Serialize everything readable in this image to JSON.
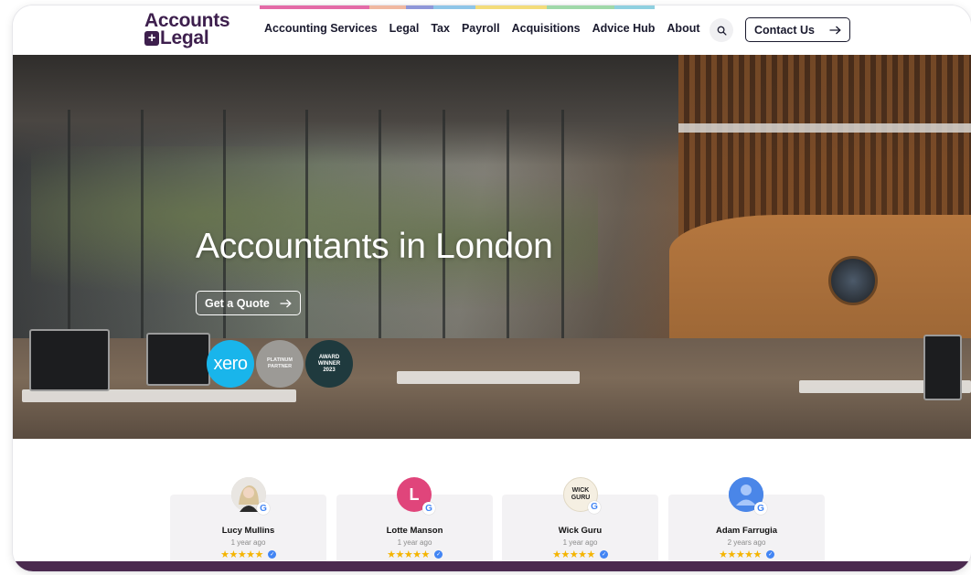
{
  "header": {
    "logo_line1": "Accounts",
    "logo_line2": "Legal",
    "nav": [
      "Accounting Services",
      "Legal",
      "Tax",
      "Payroll",
      "Acquisitions",
      "Advice Hub",
      "About"
    ],
    "contact_label": "Contact Us",
    "search_icon": "search-icon",
    "strip_colors": [
      "#e46aa7",
      "#f0b8a0",
      "#8e96d8",
      "#8ec5e8",
      "#f3dc7a",
      "#9fd8a8",
      "#8fd0e0"
    ]
  },
  "hero": {
    "title": "Accountants in London",
    "cta_label": "Get a Quote",
    "badges": {
      "xero": "xero",
      "platinum_line1": "PLATINUM",
      "platinum_line2": "PARTNER",
      "award_line1": "AWARD",
      "award_line2": "WINNER",
      "award_line3": "2023"
    }
  },
  "reviews": [
    {
      "name": "Lucy Mullins",
      "time": "1 year ago",
      "avatar_initial": "",
      "avatar_color": "#cfcac4"
    },
    {
      "name": "Lotte Manson",
      "time": "1 year ago",
      "avatar_initial": "L",
      "avatar_color": "#e0457b"
    },
    {
      "name": "Wick Guru",
      "time": "1 year ago",
      "avatar_initial": "WICK GURU",
      "avatar_color": "#f5efe2"
    },
    {
      "name": "Adam Farrugia",
      "time": "2 years ago",
      "avatar_initial": "",
      "avatar_color": "#4a86e8"
    }
  ],
  "stars": "★★★★★",
  "verified_mark": "✓",
  "google_letter": "G",
  "colors": {
    "brand": "#3d1f4d",
    "star": "#f4b400",
    "bottom_bar": "#4b2a4f"
  }
}
